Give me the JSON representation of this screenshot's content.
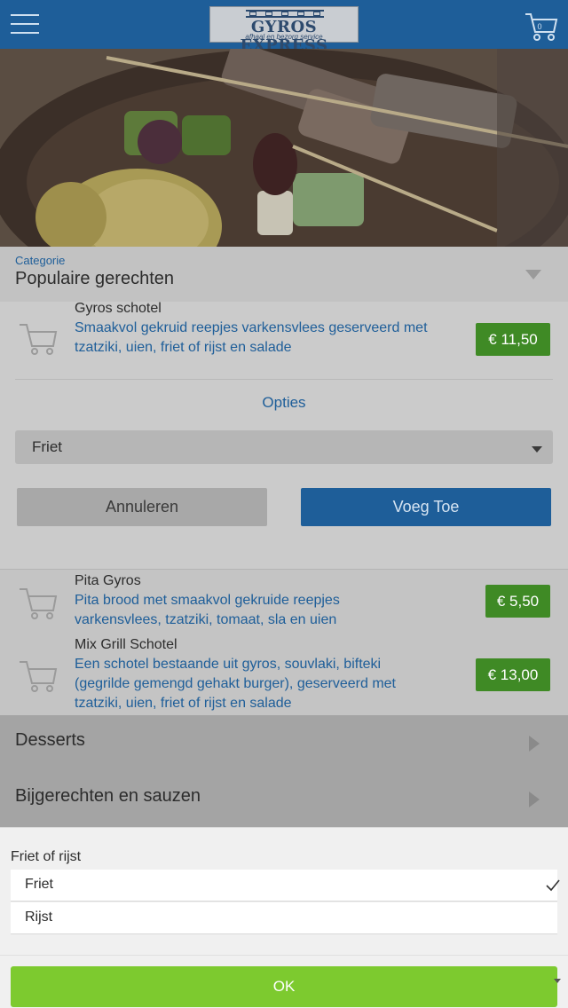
{
  "header": {
    "logo_name": "GYROS EXPRESS",
    "logo_tagline": "afhaal en bezorg service",
    "cart_count": "0"
  },
  "category": {
    "label": "Categorie",
    "value": "Populaire gerechten"
  },
  "expanded_product": {
    "name": "Gyros schotel",
    "description": "Smaakvol gekruid reepjes varkensvlees geserveerd met tzatziki, uien, friet of rijst en salade",
    "price": "€ 11,50",
    "options_label": "Opties",
    "selected_option": "Friet",
    "cancel_label": "Annuleren",
    "add_label": "Voeg Toe"
  },
  "products": [
    {
      "name": "Pita Gyros",
      "description": "Pita brood met smaakvol gekruide reepjes varkensvlees, tzatziki, tomaat, sla en uien",
      "price": "€ 5,50"
    },
    {
      "name": "Mix Grill Schotel",
      "description": "Een schotel bestaande uit gyros, souvlaki, bifteki (gegrilde gemengd gehakt burger), geserveerd met tzatziki, uien, friet of rijst en salade",
      "price": "€ 13,00"
    }
  ],
  "categories": [
    {
      "label": "Desserts"
    },
    {
      "label": "Bijgerechten en sauzen"
    }
  ],
  "picker": {
    "title": "Friet of rijst",
    "options": [
      {
        "label": "Friet",
        "selected": true
      },
      {
        "label": "Rijst",
        "selected": false
      }
    ],
    "ok_label": "OK"
  },
  "colors": {
    "header_blue": "#1e5e99",
    "price_green": "#3f8a25",
    "ok_green": "#7dca2f"
  }
}
